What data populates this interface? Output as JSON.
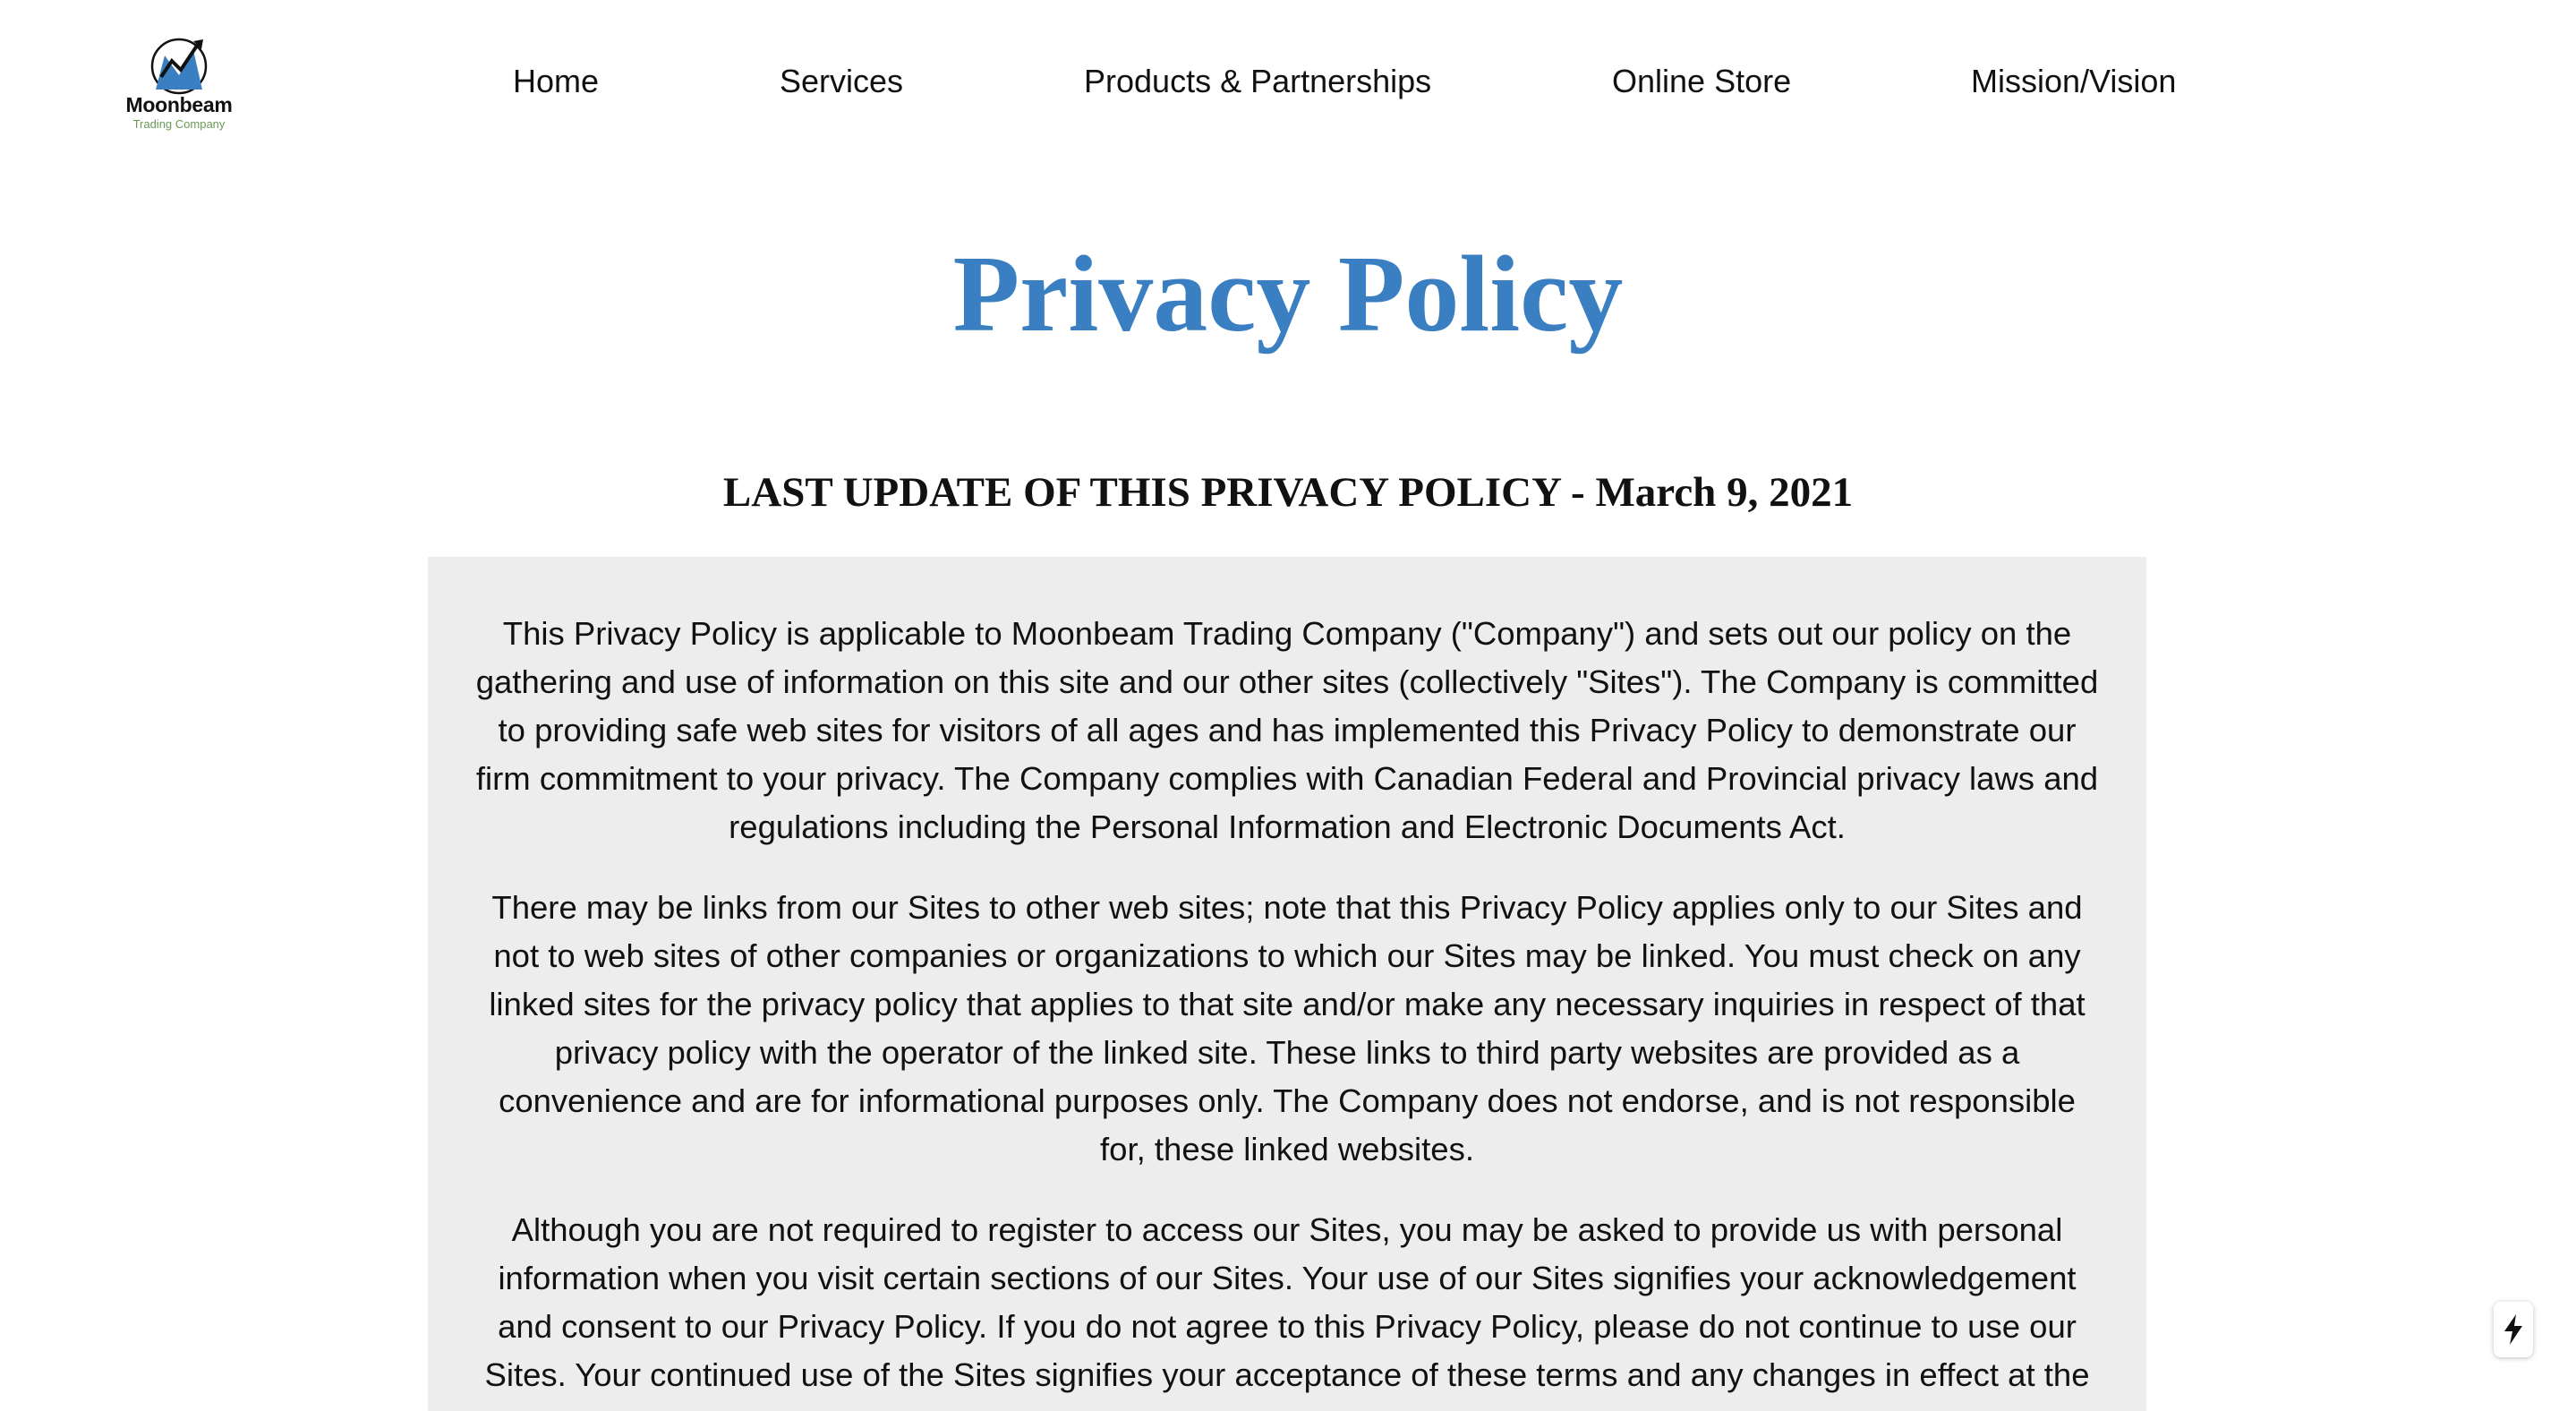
{
  "brand": {
    "name": "Moonbeam",
    "tagline": "Trading Company",
    "colors": {
      "accent": "#3a7fc1",
      "tagline": "#6a9a55",
      "panel": "#ededed"
    }
  },
  "nav": {
    "items": [
      {
        "label": "Home"
      },
      {
        "label": "Services"
      },
      {
        "label": "Products & Partnerships"
      },
      {
        "label": "Online Store"
      },
      {
        "label": "Mission/Vision"
      }
    ]
  },
  "page": {
    "title": "Privacy Policy",
    "last_update": "LAST UPDATE OF THIS PRIVACY POLICY - March 9, 2021"
  },
  "content": {
    "paragraphs": [
      "This Privacy Policy is applicable to Moonbeam Trading Company (\"Company\") and sets out our policy on the gathering and use of information on this site and our other sites (collectively \"Sites\"). The Company is committed to providing safe web sites for visitors of all ages and has implemented this Privacy Policy to demonstrate our firm commitment to your privacy. The Company complies with Canadian Federal and Provincial privacy laws and regulations including the Personal Information and Electronic Documents Act.",
      "There may be links from our Sites to other web sites; note that this Privacy Policy applies only to our Sites and not to web sites of other companies or organizations to which our Sites may be linked. You must check on any linked sites for the privacy policy that applies to that site and/or make any necessary inquiries in respect of that privacy policy with the operator of the linked site. These links to third party websites are provided as a convenience and are for informational purposes only. The Company does not endorse, and is not responsible for, these linked websites.",
      "Although you are not required to register to access our Sites, you may be asked to provide us with personal information when you visit certain sections of our Sites. Your use of our Sites signifies your acknowledgement and consent to our Privacy Policy. If you do not agree to this Privacy Policy, please do not continue to use our Sites. Your continued use of the Sites signifies your acceptance of these terms and any changes in effect at the time of use."
    ]
  },
  "widgets": {
    "quick_action_icon": "lightning-bolt-icon"
  }
}
